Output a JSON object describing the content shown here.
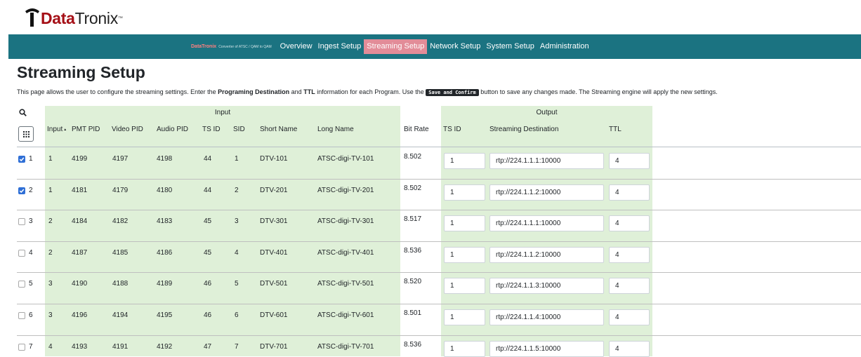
{
  "logo": {
    "text_data": "Data",
    "text_tronix": "Tronix",
    "tm": "™"
  },
  "navbar": {
    "brand_logo": "DataTronix",
    "brand_tagline": "Converter of ATSC / QAM to QAM",
    "links": [
      "Overview",
      "Ingest Setup",
      "Streaming Setup",
      "Network Setup",
      "System Setup",
      "Administration"
    ],
    "active": "Streaming Setup"
  },
  "page": {
    "title": "Streaming Setup",
    "desc_1": "This page allows the user to configure the streaming settings. Enter the ",
    "desc_b1": "Programing Destination",
    "desc_2": " and ",
    "desc_b2": "TTL",
    "desc_3": " information for each Program. Use the ",
    "desc_button": "Save and Confirm",
    "desc_4": " button to save any changes made. The Streaming engine will apply the new settings."
  },
  "table": {
    "group_input": "Input",
    "group_output": "Output",
    "headers": {
      "input": "Input",
      "pmt_pid": "PMT PID",
      "video_pid": "Video PID",
      "audio_pid": "Audio PID",
      "ts_id": "TS ID",
      "sid": "SID",
      "short_name": "Short Name",
      "long_name": "Long Name",
      "bit_rate": "Bit Rate",
      "out_ts_id": "TS ID",
      "destination": "Streaming Destination",
      "ttl": "TTL"
    },
    "sort_indicator": "▲",
    "rows": [
      {
        "num": "1",
        "checked": true,
        "input": "1",
        "pmt": "4199",
        "video": "4197",
        "audio": "4198",
        "tsid": "44",
        "sid": "1",
        "short": "DTV-101",
        "long": "ATSC-digi-TV-101",
        "bitrate": "8.502",
        "out_tsid": "1",
        "dest": "rtp://224.1.1.1:10000",
        "ttl": "4"
      },
      {
        "num": "2",
        "checked": true,
        "input": "1",
        "pmt": "4181",
        "video": "4179",
        "audio": "4180",
        "tsid": "44",
        "sid": "2",
        "short": "DTV-201",
        "long": "ATSC-digi-TV-201",
        "bitrate": "8.502",
        "out_tsid": "1",
        "dest": "rtp://224.1.1.2:10000",
        "ttl": "4"
      },
      {
        "num": "3",
        "checked": false,
        "input": "2",
        "pmt": "4184",
        "video": "4182",
        "audio": "4183",
        "tsid": "45",
        "sid": "3",
        "short": "DTV-301",
        "long": "ATSC-digi-TV-301",
        "bitrate": "8.517",
        "out_tsid": "1",
        "dest": "rtp://224.1.1.1:10000",
        "ttl": "4"
      },
      {
        "num": "4",
        "checked": false,
        "input": "2",
        "pmt": "4187",
        "video": "4185",
        "audio": "4186",
        "tsid": "45",
        "sid": "4",
        "short": "DTV-401",
        "long": "ATSC-digi-TV-401",
        "bitrate": "8.536",
        "out_tsid": "1",
        "dest": "rtp://224.1.1.2:10000",
        "ttl": "4"
      },
      {
        "num": "5",
        "checked": false,
        "input": "3",
        "pmt": "4190",
        "video": "4188",
        "audio": "4189",
        "tsid": "46",
        "sid": "5",
        "short": "DTV-501",
        "long": "ATSC-digi-TV-501",
        "bitrate": "8.520",
        "out_tsid": "1",
        "dest": "rtp://224.1.1.3:10000",
        "ttl": "4"
      },
      {
        "num": "6",
        "checked": false,
        "input": "3",
        "pmt": "4196",
        "video": "4194",
        "audio": "4195",
        "tsid": "46",
        "sid": "6",
        "short": "DTV-601",
        "long": "ATSC-digi-TV-601",
        "bitrate": "8.501",
        "out_tsid": "1",
        "dest": "rtp://224.1.1.4:10000",
        "ttl": "4"
      },
      {
        "num": "7",
        "checked": false,
        "input": "4",
        "pmt": "4193",
        "video": "4191",
        "audio": "4192",
        "tsid": "47",
        "sid": "7",
        "short": "DTV-701",
        "long": "ATSC-digi-TV-701",
        "bitrate": "8.536",
        "out_tsid": "1",
        "dest": "rtp://224.1.1.5:10000",
        "ttl": "4"
      }
    ]
  },
  "icons": {
    "search": "search-icon",
    "columns": "grid-columns-icon",
    "logo_mark": "datatronix-logo-mark"
  },
  "colors": {
    "navbar": "#1b7381",
    "nav_active": "#e28c98",
    "group_bg": "#dff0d8",
    "checkbox_on": "#2f6fd6",
    "logo_red": "#a50f16"
  }
}
